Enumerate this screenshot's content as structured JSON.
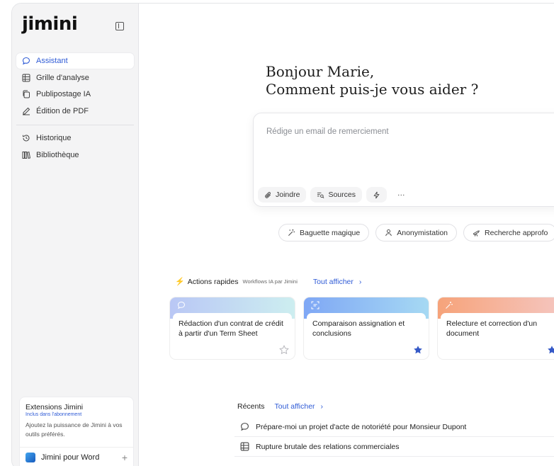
{
  "app": {
    "logo": "jimini"
  },
  "sidebar": {
    "items": [
      {
        "label": "Assistant",
        "icon": "chat-bubble-icon",
        "active": true
      },
      {
        "label": "Grille d'analyse",
        "icon": "table-grid-icon"
      },
      {
        "label": "Publipostage IA",
        "icon": "copy-docs-icon"
      },
      {
        "label": "Édition de PDF",
        "icon": "pencil-icon"
      },
      {
        "label": "Historique",
        "icon": "history-icon"
      },
      {
        "label": "Bibliothèque",
        "icon": "library-icon"
      }
    ],
    "extensions": {
      "title": "Extensions Jimini",
      "subtitle": "Inclus dans l'abonnement",
      "description": "Ajoutez la puissance de Jimini à vos outils préférés.",
      "word_label": "Jimini pour Word"
    }
  },
  "main": {
    "greeting_line1": "Bonjour Marie,",
    "greeting_line2": "Comment puis-je vous aider ?",
    "composer": {
      "placeholder": "Rédige un email de remerciement",
      "attach_label": "Joindre",
      "sources_label": "Sources",
      "more_label": "···"
    },
    "chips": [
      {
        "label": "Baguette magique",
        "icon": "magic-wand-icon"
      },
      {
        "label": "Anonymistation",
        "icon": "user-icon"
      },
      {
        "label": "Recherche approfo",
        "icon": "telescope-icon"
      }
    ],
    "quick_actions": {
      "title": "Actions rapides",
      "subtitle": "Workflows IA par Jimini",
      "link": "Tout afficher",
      "cards": [
        {
          "label": "Rédaction d'un contrat de crédit à partir d'un Term Sheet",
          "starred": false,
          "band": [
            "#b9c7f5",
            "#cdeef0"
          ]
        },
        {
          "label": "Comparaison assignation et conclusions",
          "starred": true,
          "band": [
            "#7fa7f5",
            "#a6d9f3"
          ]
        },
        {
          "label": "Relecture et correction d'un document",
          "starred": true,
          "band": [
            "#f6a37a",
            "#f5c6c0"
          ]
        }
      ]
    },
    "recents": {
      "title": "Récents",
      "link": "Tout afficher",
      "items": [
        {
          "label": "Prépare-moi un projet d'acte de notoriété pour Monsieur Dupont",
          "icon": "chat-bubble-icon"
        },
        {
          "label": "Rupture brutale des relations commerciales",
          "icon": "table-grid-icon"
        }
      ]
    }
  }
}
